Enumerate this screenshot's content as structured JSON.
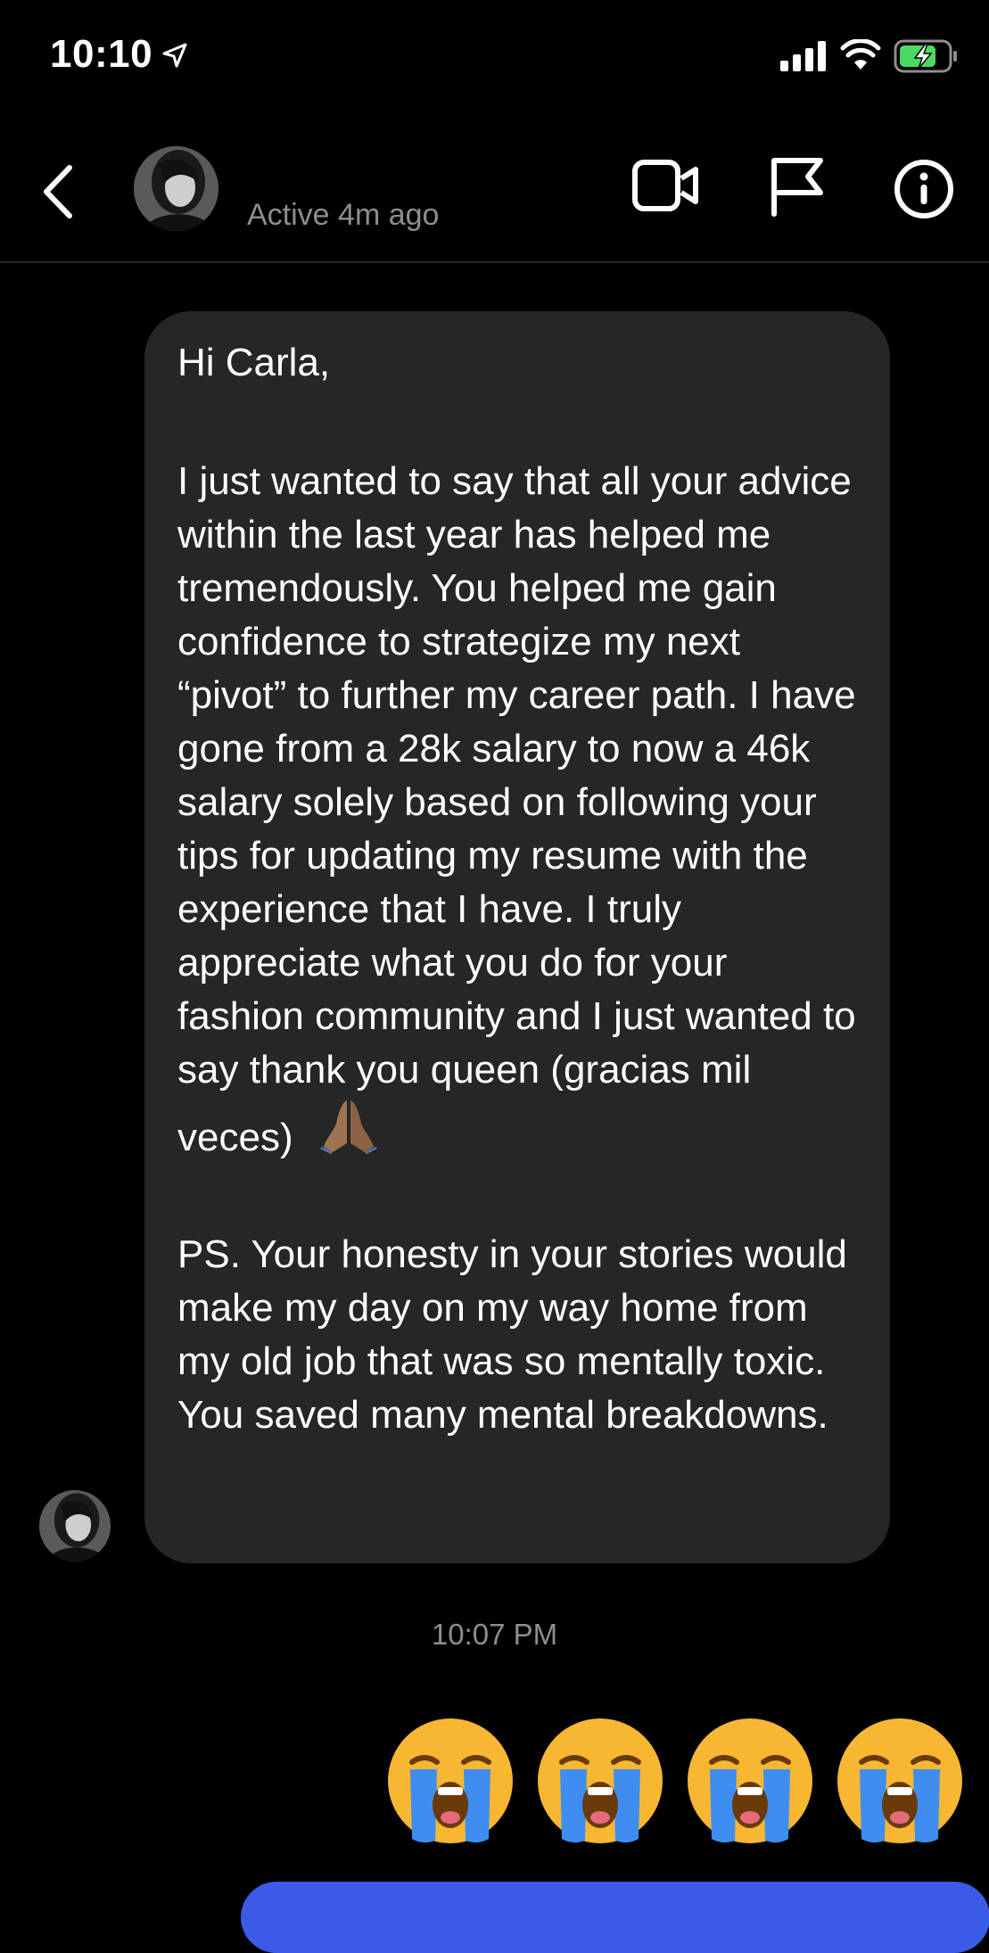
{
  "status_bar": {
    "time": "10:10",
    "icons": [
      "location-arrow-icon",
      "cellular-signal-icon",
      "wifi-icon",
      "battery-charging-icon"
    ]
  },
  "header": {
    "back_icon": "chevron-left-icon",
    "active_status": "Active 4m ago",
    "actions": [
      "video-call-icon",
      "flag-icon",
      "info-icon"
    ]
  },
  "message": {
    "greeting": "Hi Carla,",
    "body": "I just wanted to say that all your advice within the last year has helped me tremendously. You helped me gain confidence to strategize my next “pivot” to further my career path. I have gone from a 28k salary to now a 46k salary solely based on following your tips for updating my resume with the experience that I have. I truly appreciate what you do for your fashion community and I just wanted to say thank you queen (gracias mil veces)",
    "body_emoji": "folded-hands-emoji",
    "ps": "PS. Your honesty in your stories would make my day on my way home from my old job that was so mentally toxic. You saved many mental breakdowns."
  },
  "timestamp": "10:07 PM",
  "reply": {
    "emojis": [
      "loudly-crying-face-emoji",
      "loudly-crying-face-emoji",
      "loudly-crying-face-emoji",
      "loudly-crying-face-emoji"
    ]
  },
  "colors": {
    "background": "#000000",
    "bubble": "#262626",
    "secondary_text": "#8e8e8e",
    "accent": "#3a5ae8",
    "battery": "#4cd964"
  }
}
